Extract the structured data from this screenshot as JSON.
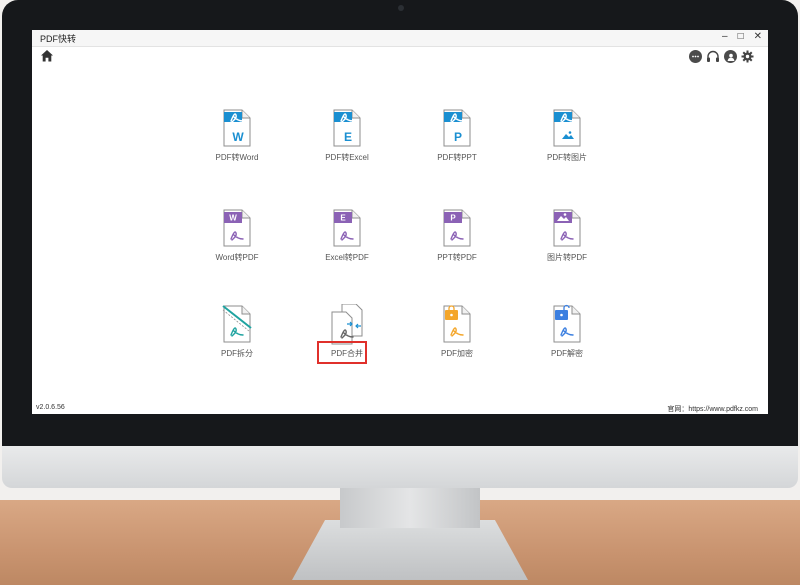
{
  "app": {
    "title": "PDF快转",
    "window_controls": {
      "minimize": "–",
      "maximize": "□",
      "close": "✕"
    },
    "toolbar": {
      "home_icon": "home-icon",
      "right_icons": [
        "chat-icon",
        "headset-icon",
        "user-icon",
        "gear-icon"
      ]
    },
    "tools": [
      {
        "id": "pdf-to-word",
        "label": "PDF转Word",
        "badge": "W",
        "color": "#1a8fd1",
        "kind": "from-pdf"
      },
      {
        "id": "pdf-to-excel",
        "label": "PDF转Excel",
        "badge": "E",
        "color": "#1a8fd1",
        "kind": "from-pdf"
      },
      {
        "id": "pdf-to-ppt",
        "label": "PDF转PPT",
        "badge": "P",
        "color": "#1a8fd1",
        "kind": "from-pdf"
      },
      {
        "id": "pdf-to-image",
        "label": "PDF转图片",
        "badge": "image",
        "color": "#1a8fd1",
        "kind": "from-pdf"
      },
      {
        "id": "word-to-pdf",
        "label": "Word转PDF",
        "badge": "W",
        "color": "#8b62b5",
        "kind": "to-pdf"
      },
      {
        "id": "excel-to-pdf",
        "label": "Excel转PDF",
        "badge": "E",
        "color": "#8b62b5",
        "kind": "to-pdf"
      },
      {
        "id": "ppt-to-pdf",
        "label": "PPT转PDF",
        "badge": "P",
        "color": "#8b62b5",
        "kind": "to-pdf"
      },
      {
        "id": "image-to-pdf",
        "label": "图片转PDF",
        "badge": "image",
        "color": "#8b62b5",
        "kind": "to-pdf"
      },
      {
        "id": "pdf-split",
        "label": "PDF拆分",
        "badge": "split",
        "color": "#1fa3a0",
        "kind": "split"
      },
      {
        "id": "pdf-merge",
        "label": "PDF合并",
        "badge": "merge",
        "color": "#1a8fd1",
        "kind": "merge"
      },
      {
        "id": "pdf-encrypt",
        "label": "PDF加密",
        "badge": "lock",
        "color": "#f4a62a",
        "kind": "lock"
      },
      {
        "id": "pdf-decrypt",
        "label": "PDF解密",
        "badge": "unlock",
        "color": "#3b7fe0",
        "kind": "unlock"
      }
    ],
    "footer": {
      "version": "v2.0.6.56",
      "website_label": "官网：",
      "website_url": "https://www.pdfkz.com"
    }
  }
}
